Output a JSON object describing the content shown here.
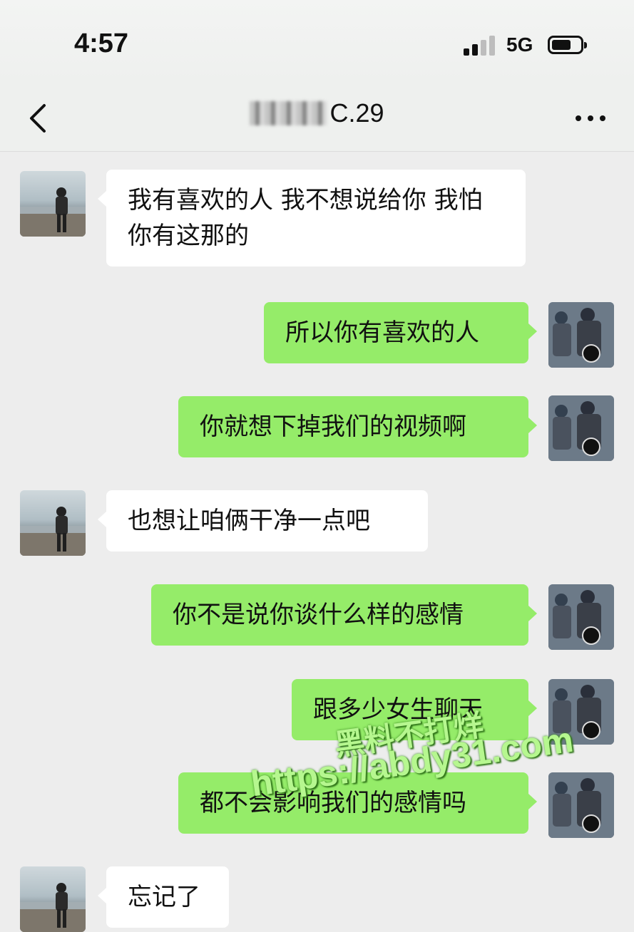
{
  "status_bar": {
    "time": "4:57",
    "network": "5G"
  },
  "nav": {
    "title": "C.29"
  },
  "messages": [
    {
      "sender": "other",
      "text": "我有喜欢的人 我不想说给你 我怕你有这那的"
    },
    {
      "sender": "me",
      "text": "所以你有喜欢的人"
    },
    {
      "sender": "me",
      "text": "你就想下掉我们的视频啊"
    },
    {
      "sender": "other",
      "text": "也想让咱俩干净一点吧"
    },
    {
      "sender": "me",
      "text": "你不是说你谈什么样的感情"
    },
    {
      "sender": "me",
      "text": "跟多少女生聊天"
    },
    {
      "sender": "me",
      "text": "都不会影响我们的感情吗"
    },
    {
      "sender": "other",
      "text": "忘记了"
    }
  ],
  "watermark": {
    "line1": "黑料不打烊",
    "line2": "https://abdy31.com"
  },
  "colors": {
    "my_bubble": "#95ec69",
    "other_bubble": "#ffffff",
    "background": "#ededed"
  }
}
